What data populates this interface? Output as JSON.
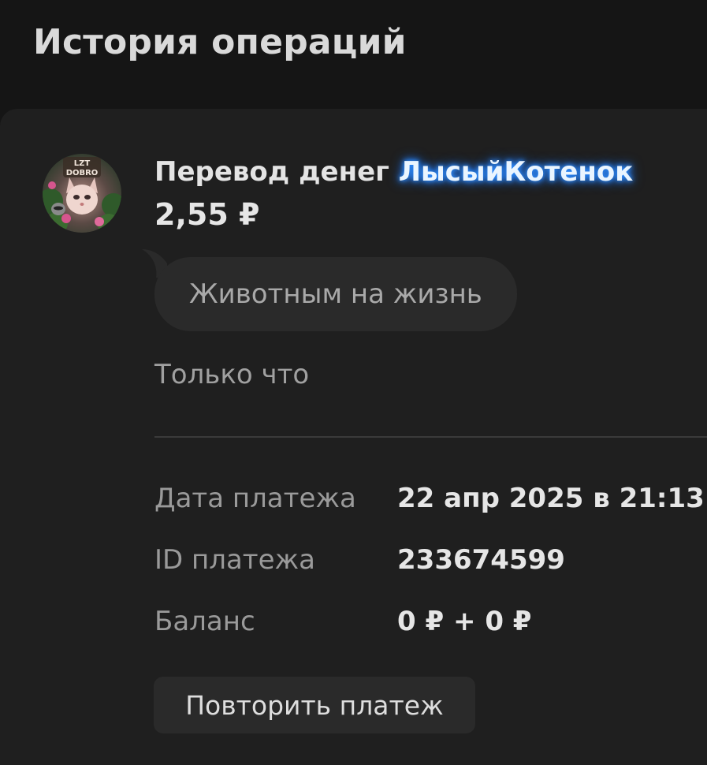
{
  "header": {
    "title": "История операций"
  },
  "transaction": {
    "avatar": {
      "icon": "avatar-image",
      "badge_text": "LZT DOBRO"
    },
    "title_prefix": "Перевод денег",
    "username": "ЛысыйКотенок",
    "username_glow_color": "#2e8dff",
    "amount": "2,55 ₽",
    "comment": "Животным на жизнь",
    "time_ago": "Только что"
  },
  "details": [
    {
      "label": "Дата платежа",
      "value": "22 апр 2025 в 21:13"
    },
    {
      "label": "ID платежа",
      "value": "233674599"
    },
    {
      "label": "Баланс",
      "value": "0 ₽ + 0 ₽"
    }
  ],
  "actions": {
    "repeat_label": "Повторить платеж"
  }
}
